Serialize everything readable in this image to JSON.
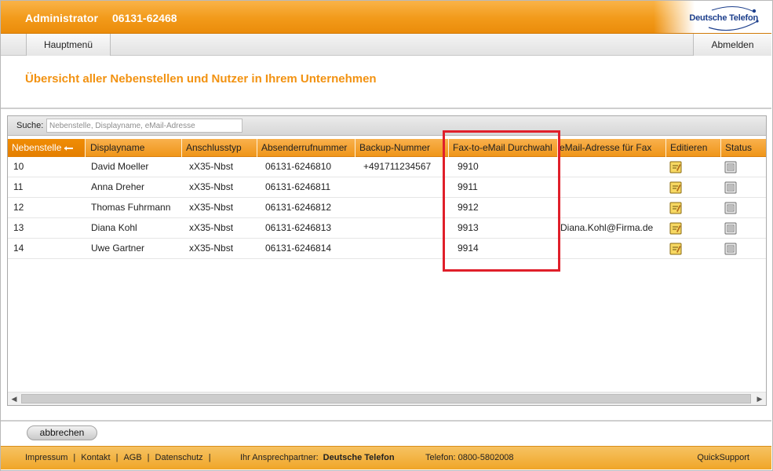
{
  "header": {
    "title": "Administrator",
    "phone": "06131-62468",
    "logo_text": "Deutsche Telefon"
  },
  "nav": {
    "main_menu": "Hauptmenü",
    "logout": "Abmelden"
  },
  "page_title": "Übersicht aller Nebenstellen und Nutzer in Ihrem Unternehmen",
  "search": {
    "label": "Suche:",
    "placeholder": "Nebenstelle, Displayname, eMail-Adresse",
    "value": ""
  },
  "table": {
    "columns": [
      "Nebenstelle",
      "Displayname",
      "Anschlusstyp",
      "Absenderrufnummer",
      "Backup-Nummer",
      "Fax-to-eMail Durchwahl",
      "eMail-Adresse für Fax",
      "Editieren",
      "Status"
    ],
    "sorted_column": "Nebenstelle",
    "rows": [
      {
        "ext": "10",
        "name": "David Moeller",
        "type": "xX35-Nbst",
        "sender": "06131-6246810",
        "backup": "+491711234567",
        "fax": "9910",
        "email": ""
      },
      {
        "ext": "11",
        "name": "Anna Dreher",
        "type": "xX35-Nbst",
        "sender": "06131-6246811",
        "backup": "",
        "fax": "9911",
        "email": ""
      },
      {
        "ext": "12",
        "name": "Thomas Fuhrmann",
        "type": "xX35-Nbst",
        "sender": "06131-6246812",
        "backup": "",
        "fax": "9912",
        "email": ""
      },
      {
        "ext": "13",
        "name": "Diana Kohl",
        "type": "xX35-Nbst",
        "sender": "06131-6246813",
        "backup": "",
        "fax": "9913",
        "email": "Diana.Kohl@Firma.de"
      },
      {
        "ext": "14",
        "name": "Uwe Gartner",
        "type": "xX35-Nbst",
        "sender": "06131-6246814",
        "backup": "",
        "fax": "9914",
        "email": ""
      }
    ]
  },
  "buttons": {
    "cancel": "abbrechen"
  },
  "footer": {
    "links": [
      "Impressum",
      "Kontakt",
      "AGB",
      "Datenschutz"
    ],
    "partner_label": "Ihr Ansprechpartner:",
    "partner_name": "Deutsche Telefon",
    "phone": "Telefon: 0800-5802008",
    "quick_support": "QuickSupport"
  },
  "colors": {
    "brand_orange": "#f29a1a",
    "title_orange": "#f29211",
    "highlight_red": "#e01f2a",
    "logo_blue": "#1d3f8c"
  },
  "icons": {
    "edit": "edit-icon",
    "status": "status-icon",
    "sort": "sort-ascending-icon",
    "scroll_left": "scroll-left-arrow-icon",
    "scroll_right": "scroll-right-arrow-icon"
  }
}
